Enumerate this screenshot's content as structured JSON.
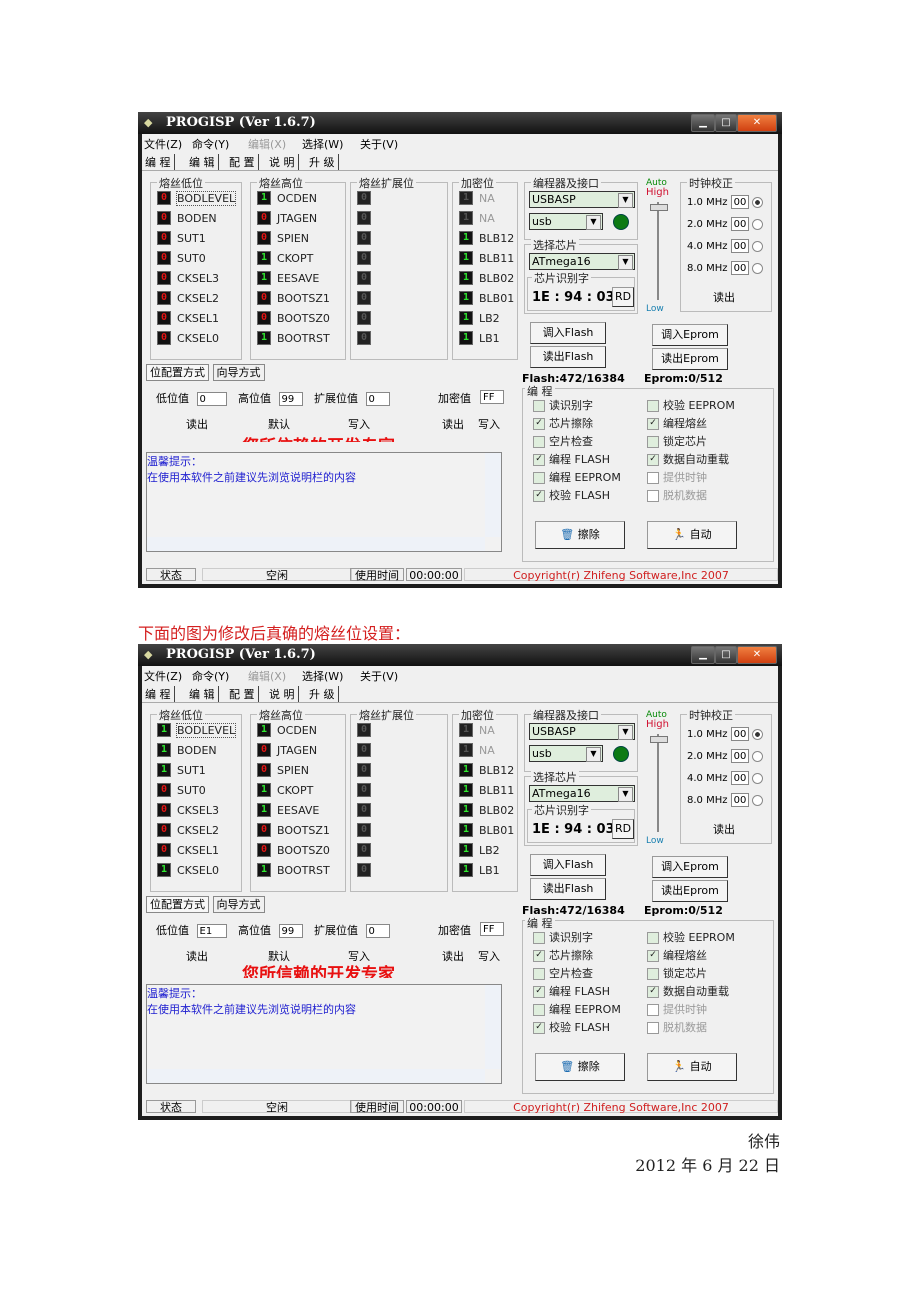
{
  "caption": "下面的图为修改后真确的熔丝位设置：",
  "signature": {
    "author": "徐伟",
    "date": "2012 年 6 月 22 日"
  },
  "app": {
    "title": "PROGISP (Ver 1.6.7)",
    "menu": [
      "文件(Z)",
      "命令(Y)",
      "编辑(X)",
      "选择(W)",
      "关于(V)"
    ],
    "menu_disabled": [
      false,
      false,
      true,
      false,
      false
    ],
    "tabs": [
      "编 程",
      "编 辑",
      "配 置",
      "说 明",
      "升 级"
    ],
    "groups": {
      "low": "熔丝低位",
      "high": "熔丝高位",
      "ext": "熔丝扩展位",
      "lock": "加密位"
    },
    "subtabs": [
      "位配置方式",
      "向导方式"
    ],
    "labels": {
      "low_val": "低位值",
      "high_val": "高位值",
      "ext_val": "扩展位值",
      "lock_val": "加密值"
    },
    "actions": {
      "read": "读出",
      "default": "默认",
      "write": "写入",
      "lock_read": "读出",
      "lock_write": "写入"
    },
    "banner": "您所信赖的开发专家",
    "memo": [
      "温馨提示：",
      "在使用本软件之前建议先浏览说明栏的内容"
    ],
    "status": {
      "label": "状态",
      "value": "空闲",
      "time_label": "使用时间",
      "time": "00:00:00",
      "copyright": "Copyright(r) Zhifeng Software,Inc 2007"
    },
    "programmer": {
      "group": "编程器及接口",
      "device": "USBASP",
      "port": "usb"
    },
    "chip": {
      "group": "选择芯片",
      "name": "ATmega16",
      "sig_group": "芯片识别字",
      "signature": "1E : 94 : 03",
      "rd": "RD"
    },
    "speed": {
      "auto": "Auto",
      "high": "High",
      "low": "Low"
    },
    "clock": {
      "group": "时钟校正",
      "rows": [
        {
          "label": "1.0 MHz",
          "value": "00",
          "selected": true
        },
        {
          "label": "2.0 MHz",
          "value": "00",
          "selected": false
        },
        {
          "label": "4.0 MHz",
          "value": "00",
          "selected": false
        },
        {
          "label": "8.0 MHz",
          "value": "00",
          "selected": false
        }
      ],
      "read": "读出"
    },
    "buttons": {
      "load_flash": "调入Flash",
      "load_eprom": "调入Eprom",
      "read_flash": "读出Flash",
      "read_eprom": "读出Eprom",
      "erase": "擦除",
      "auto": "自动"
    },
    "sizes": {
      "flash": "Flash:472/16384",
      "eprom": "Eprom:0/512"
    },
    "prog_group": "编 程",
    "options": [
      {
        "label": "读识别字",
        "checked": false,
        "disabled": false
      },
      {
        "label": "校验 EEPROM",
        "checked": false,
        "disabled": false
      },
      {
        "label": "芯片擦除",
        "checked": true,
        "disabled": false
      },
      {
        "label": "编程熔丝",
        "checked": true,
        "disabled": false
      },
      {
        "label": "空片检查",
        "checked": false,
        "disabled": false
      },
      {
        "label": "锁定芯片",
        "checked": false,
        "disabled": false
      },
      {
        "label": "编程 FLASH",
        "checked": true,
        "disabled": false
      },
      {
        "label": "数据自动重载",
        "checked": true,
        "disabled": false
      },
      {
        "label": "编程 EEPROM",
        "checked": false,
        "disabled": false
      },
      {
        "label": "提供时钟",
        "checked": false,
        "disabled": true
      },
      {
        "label": "校验 FLASH",
        "checked": true,
        "disabled": false
      },
      {
        "label": "脱机数据",
        "checked": false,
        "disabled": true
      }
    ]
  },
  "screens": [
    {
      "low_fuses": [
        {
          "name": "BODLEVEL",
          "bit": 0
        },
        {
          "name": "BODEN",
          "bit": 0
        },
        {
          "name": "SUT1",
          "bit": 0
        },
        {
          "name": "SUT0",
          "bit": 0
        },
        {
          "name": "CKSEL3",
          "bit": 0
        },
        {
          "name": "CKSEL2",
          "bit": 0
        },
        {
          "name": "CKSEL1",
          "bit": 0
        },
        {
          "name": "CKSEL0",
          "bit": 0
        }
      ],
      "high_fuses": [
        {
          "name": "OCDEN",
          "bit": 1
        },
        {
          "name": "JTAGEN",
          "bit": 0
        },
        {
          "name": "SPIEN",
          "bit": 0
        },
        {
          "name": "CKOPT",
          "bit": 1
        },
        {
          "name": "EESAVE",
          "bit": 1
        },
        {
          "name": "BOOTSZ1",
          "bit": 0
        },
        {
          "name": "BOOTSZ0",
          "bit": 0
        },
        {
          "name": "BOOTRST",
          "bit": 1
        }
      ],
      "ext_fuses": [
        0,
        0,
        0,
        0,
        0,
        0,
        0,
        0
      ],
      "lock_bits": [
        {
          "name": "NA",
          "bit": 1,
          "disabled": true
        },
        {
          "name": "NA",
          "bit": 1,
          "disabled": true
        },
        {
          "name": "BLB12",
          "bit": 1
        },
        {
          "name": "BLB11",
          "bit": 1
        },
        {
          "name": "BLB02",
          "bit": 1
        },
        {
          "name": "BLB01",
          "bit": 1
        },
        {
          "name": "LB2",
          "bit": 1
        },
        {
          "name": "LB1",
          "bit": 1
        }
      ],
      "values": {
        "low": "0",
        "high": "99",
        "ext": "0",
        "lock": "FF"
      }
    },
    {
      "low_fuses": [
        {
          "name": "BODLEVEL",
          "bit": 1
        },
        {
          "name": "BODEN",
          "bit": 1
        },
        {
          "name": "SUT1",
          "bit": 1
        },
        {
          "name": "SUT0",
          "bit": 0
        },
        {
          "name": "CKSEL3",
          "bit": 0
        },
        {
          "name": "CKSEL2",
          "bit": 0
        },
        {
          "name": "CKSEL1",
          "bit": 0
        },
        {
          "name": "CKSEL0",
          "bit": 1
        }
      ],
      "high_fuses": [
        {
          "name": "OCDEN",
          "bit": 1
        },
        {
          "name": "JTAGEN",
          "bit": 0
        },
        {
          "name": "SPIEN",
          "bit": 0
        },
        {
          "name": "CKOPT",
          "bit": 1
        },
        {
          "name": "EESAVE",
          "bit": 1
        },
        {
          "name": "BOOTSZ1",
          "bit": 0
        },
        {
          "name": "BOOTSZ0",
          "bit": 0
        },
        {
          "name": "BOOTRST",
          "bit": 1
        }
      ],
      "ext_fuses": [
        0,
        0,
        0,
        0,
        0,
        0,
        0,
        0
      ],
      "lock_bits": [
        {
          "name": "NA",
          "bit": 1,
          "disabled": true
        },
        {
          "name": "NA",
          "bit": 1,
          "disabled": true
        },
        {
          "name": "BLB12",
          "bit": 1
        },
        {
          "name": "BLB11",
          "bit": 1
        },
        {
          "name": "BLB02",
          "bit": 1
        },
        {
          "name": "BLB01",
          "bit": 1
        },
        {
          "name": "LB2",
          "bit": 1
        },
        {
          "name": "LB1",
          "bit": 1
        }
      ],
      "values": {
        "low": "E1",
        "high": "99",
        "ext": "0",
        "lock": "FF"
      }
    }
  ]
}
